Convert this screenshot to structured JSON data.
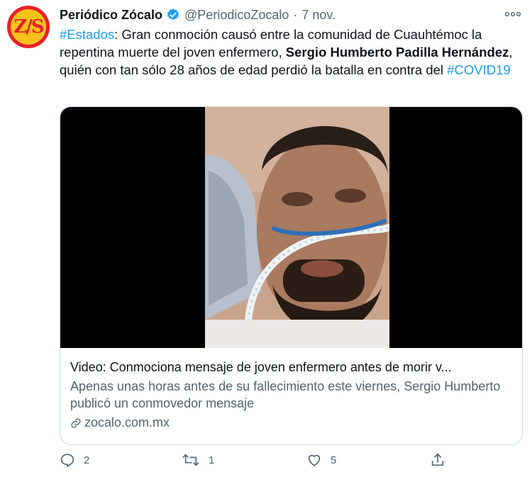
{
  "author": {
    "name": "Periódico Zócalo",
    "handle": "@PeriodicoZocalo",
    "date": "7 nov.",
    "avatar_text": "Z/S",
    "separator": "·"
  },
  "tweet": {
    "hashtag_estados": "#Estados",
    "text_1": ": Gran conmoción causó entre la comunidad de Cuauhtémoc la repentina muerte del joven enfermero, ",
    "bold_name": "Sergio Humberto Padilla Hernández",
    "text_2": ", quién con tan sólo 28 años de edad perdió la batalla en contra del ",
    "hashtag_covid": "#COVID19"
  },
  "card": {
    "title": "Video: Conmociona mensaje de joven enfermero antes de morir v...",
    "description": "Apenas unas horas antes de su fallecimiento este viernes, Sergio Humberto publicó un conmovedor mensaje",
    "domain": "zocalo.com.mx"
  },
  "actions": {
    "reply_count": "2",
    "retweet_count": "1",
    "like_count": "5"
  },
  "colors": {
    "link": "#1d9bf0",
    "verified": "#1d9bf0",
    "muted": "#536471",
    "border": "#cfd9de"
  }
}
